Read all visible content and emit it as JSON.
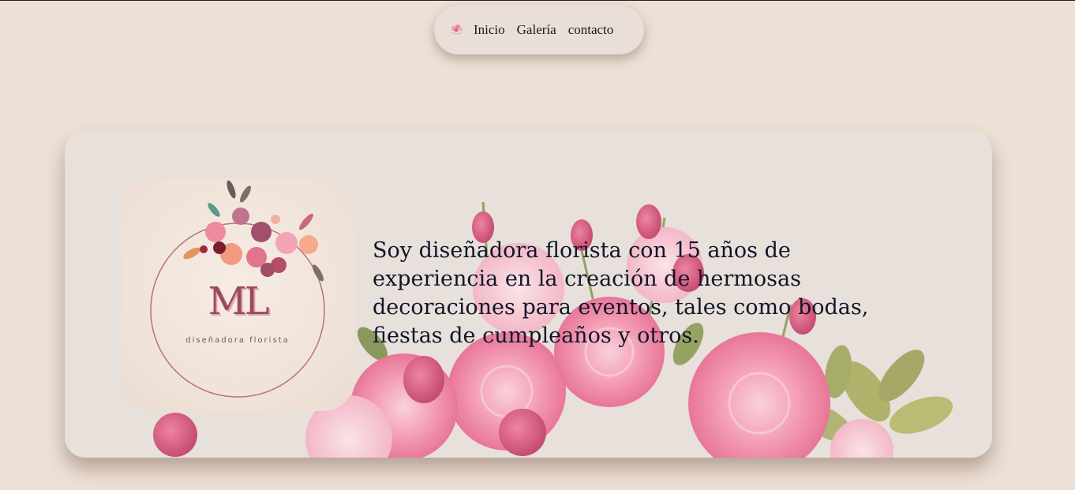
{
  "nav": {
    "logo_icon": "flower-logo-icon",
    "links": [
      "Inicio",
      "Galería",
      "contacto"
    ]
  },
  "hero": {
    "logo": {
      "monogram": "ML",
      "subtitle": "diseñadora florista"
    },
    "intro": "Soy diseñadora florista con 15 años de experiencia en la creación de hermosas decoraciones para eventos, tales como bodas, fiestas de cumpleaños y otros.",
    "background_image": "pink-roses-bouquet"
  },
  "colors": {
    "page_bg": "#ede0d5",
    "card_bg": "#e8e0da",
    "rose_pink": "#f07a9c",
    "monogram": "#9a4a5a"
  }
}
